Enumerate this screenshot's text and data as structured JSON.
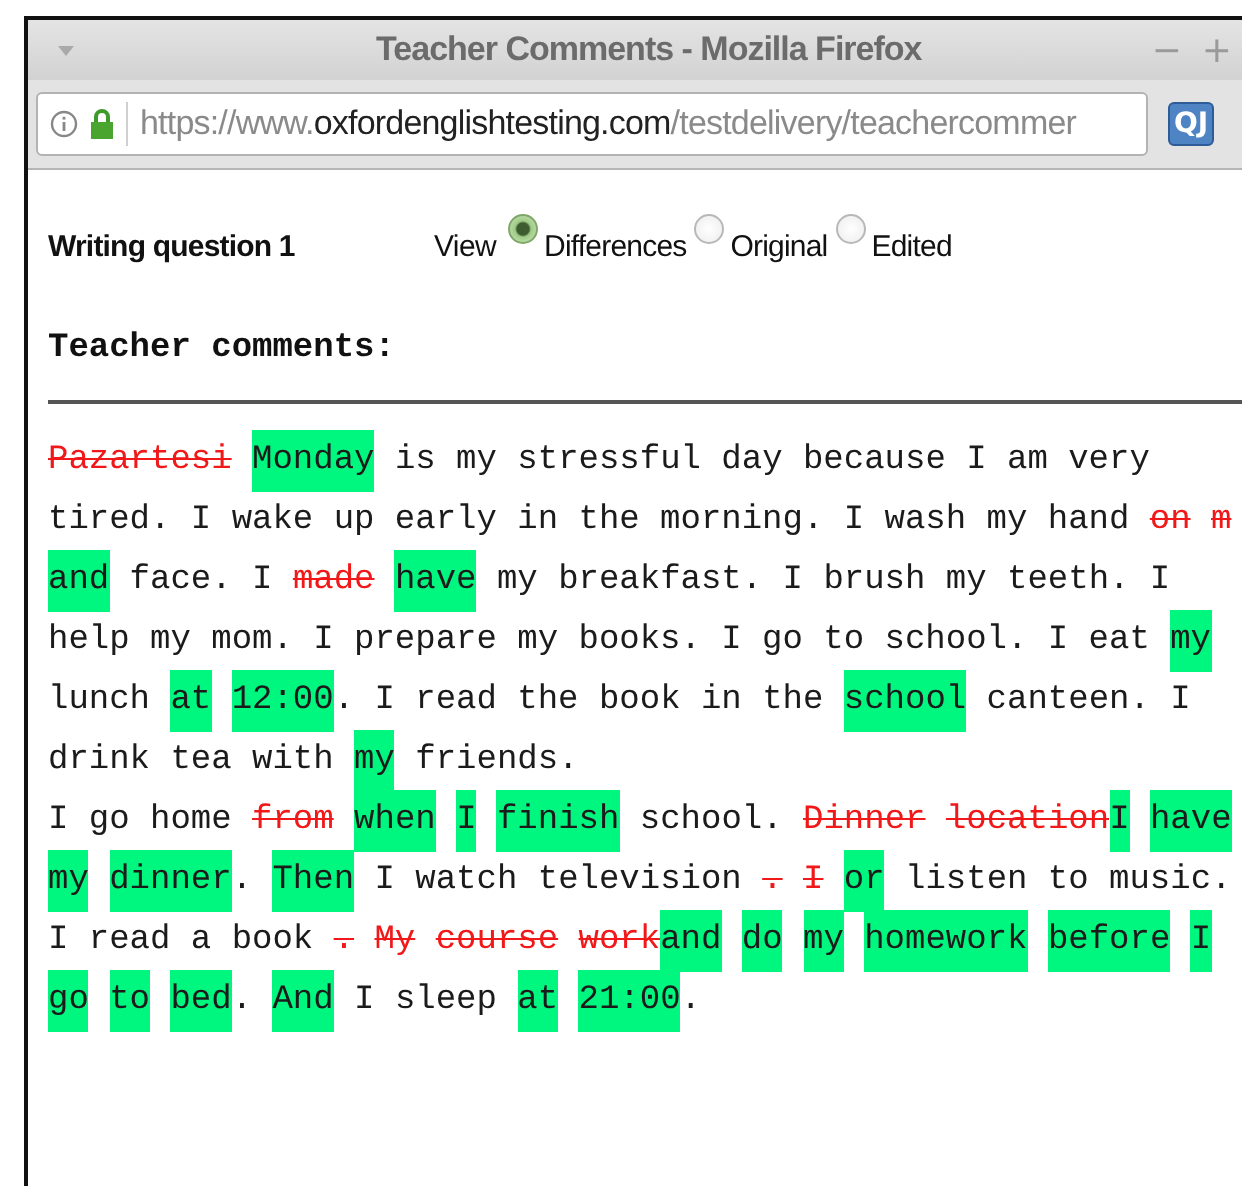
{
  "window": {
    "title": "Teacher Comments - Mozilla Firefox",
    "controls": [
      "−",
      "+"
    ]
  },
  "address_bar": {
    "url_parts": [
      {
        "kind": "dim",
        "text": "https://www."
      },
      {
        "kind": "host",
        "text": "oxfordenglishtesting.com"
      },
      {
        "kind": "dim",
        "text": "/testdelivery/teachercommer"
      }
    ],
    "extension_badge": "QJ"
  },
  "question": {
    "title": "Writing question 1",
    "view_label": "View",
    "views": [
      {
        "label": "Differences",
        "selected": true
      },
      {
        "label": "Original",
        "selected": false
      },
      {
        "label": "Edited",
        "selected": false
      }
    ]
  },
  "comments": {
    "heading": "Teacher comments:",
    "lines": [
      [
        {
          "kind": "deleted",
          "text": "Pazartesi"
        },
        {
          "kind": "inserted",
          "text": "Monday",
          "space_before": true
        },
        {
          "kind": "plain",
          "text": " is my stressful day because I am very"
        }
      ],
      [
        {
          "kind": "plain",
          "text": "tired. I wake up early in the morning. I wash my hand "
        },
        {
          "kind": "deleted",
          "text": "on"
        },
        {
          "kind": "deleted",
          "text": "m",
          "space_before": true
        }
      ],
      [
        {
          "kind": "inserted",
          "text": "and"
        },
        {
          "kind": "plain",
          "text": " face. I "
        },
        {
          "kind": "deleted",
          "text": "made"
        },
        {
          "kind": "inserted",
          "text": "have",
          "space_before": true
        },
        {
          "kind": "plain",
          "text": " my breakfast. I brush my teeth. I"
        }
      ],
      [
        {
          "kind": "plain",
          "text": "help my mom. I prepare my books. I go to school. I eat "
        },
        {
          "kind": "inserted",
          "text": "my"
        }
      ],
      [
        {
          "kind": "plain",
          "text": "lunch "
        },
        {
          "kind": "inserted",
          "text": "at"
        },
        {
          "kind": "inserted",
          "text": "12:00",
          "space_before": true
        },
        {
          "kind": "plain",
          "text": ". I read the book in the "
        },
        {
          "kind": "inserted",
          "text": "school"
        },
        {
          "kind": "plain",
          "text": " canteen. I"
        }
      ],
      [
        {
          "kind": "plain",
          "text": "drink tea with "
        },
        {
          "kind": "inserted",
          "text": "my"
        },
        {
          "kind": "plain",
          "text": " friends."
        }
      ],
      [
        {
          "kind": "plain",
          "text": "I go home "
        },
        {
          "kind": "deleted",
          "text": "from"
        },
        {
          "kind": "inserted",
          "text": "when",
          "space_before": true
        },
        {
          "kind": "inserted",
          "text": "I",
          "space_before": true
        },
        {
          "kind": "inserted",
          "text": "finish",
          "space_before": true
        },
        {
          "kind": "plain",
          "text": " school. "
        },
        {
          "kind": "deleted",
          "text": "Dinner"
        },
        {
          "kind": "deleted",
          "text": "location",
          "space_before": true
        },
        {
          "kind": "inserted",
          "text": "I"
        },
        {
          "kind": "inserted",
          "text": "have",
          "space_before": true
        }
      ],
      [
        {
          "kind": "inserted",
          "text": "my"
        },
        {
          "kind": "inserted",
          "text": "dinner",
          "space_before": true
        },
        {
          "kind": "plain",
          "text": ". "
        },
        {
          "kind": "inserted",
          "text": "Then"
        },
        {
          "kind": "plain",
          "text": " I watch television "
        },
        {
          "kind": "deleted",
          "text": "."
        },
        {
          "kind": "deleted",
          "text": "I",
          "space_before": true
        },
        {
          "kind": "inserted",
          "text": "or",
          "space_before": true
        },
        {
          "kind": "plain",
          "text": " listen to music."
        }
      ],
      [
        {
          "kind": "plain",
          "text": "I read a book "
        },
        {
          "kind": "deleted",
          "text": "."
        },
        {
          "kind": "deleted",
          "text": "My",
          "space_before": true
        },
        {
          "kind": "deleted",
          "text": "course",
          "space_before": true
        },
        {
          "kind": "deleted",
          "text": "work",
          "space_before": true
        },
        {
          "kind": "inserted",
          "text": "and"
        },
        {
          "kind": "inserted",
          "text": "do",
          "space_before": true
        },
        {
          "kind": "inserted",
          "text": "my",
          "space_before": true
        },
        {
          "kind": "inserted",
          "text": "homework",
          "space_before": true
        },
        {
          "kind": "inserted",
          "text": "before",
          "space_before": true
        },
        {
          "kind": "inserted",
          "text": "I",
          "space_before": true
        }
      ],
      [
        {
          "kind": "inserted",
          "text": "go"
        },
        {
          "kind": "inserted",
          "text": "to",
          "space_before": true
        },
        {
          "kind": "inserted",
          "text": "bed",
          "space_before": true
        },
        {
          "kind": "plain",
          "text": ". "
        },
        {
          "kind": "inserted",
          "text": "And"
        },
        {
          "kind": "plain",
          "text": " I sleep "
        },
        {
          "kind": "inserted",
          "text": "at"
        },
        {
          "kind": "inserted",
          "text": "21:00",
          "space_before": true
        },
        {
          "kind": "plain",
          "text": "."
        }
      ]
    ]
  }
}
